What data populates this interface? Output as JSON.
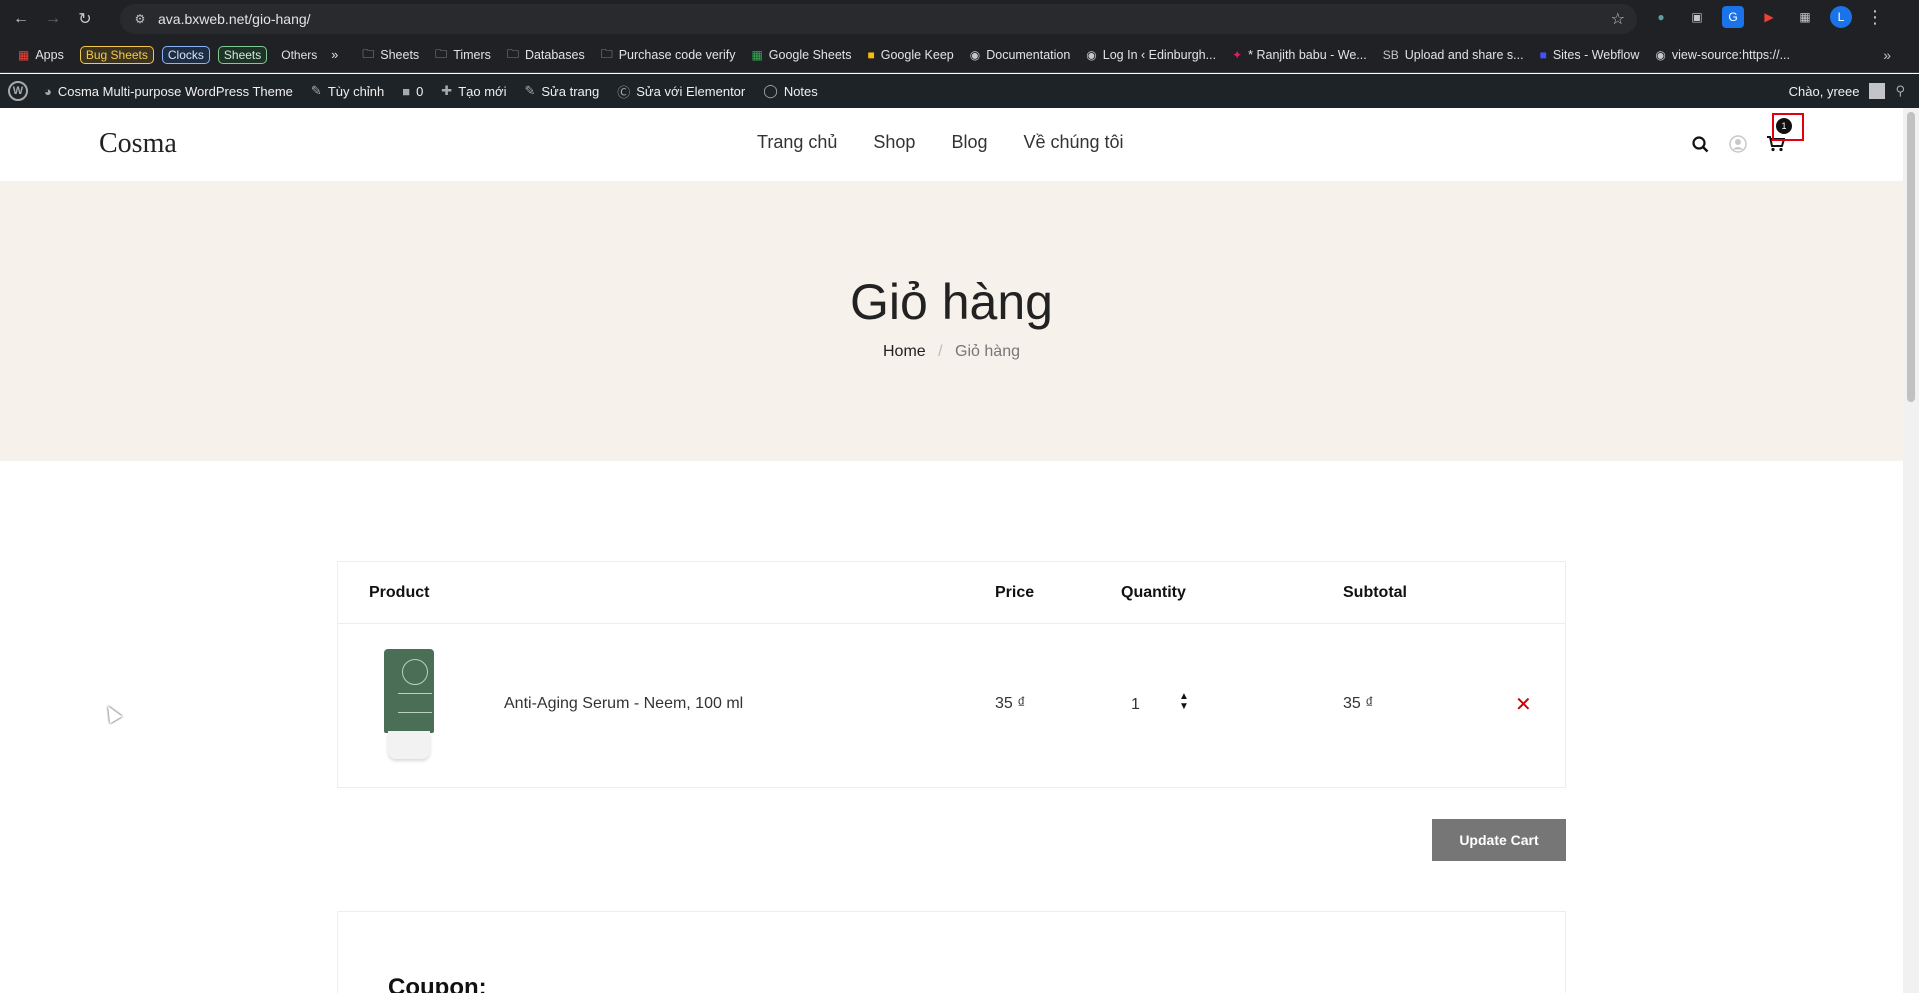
{
  "browser": {
    "url": "ava.bxweb.net/gio-hang/",
    "profile_initial": "L"
  },
  "bookmarks": {
    "apps": "Apps",
    "chips": [
      "Bug Sheets",
      "Clocks",
      "Sheets",
      "Others"
    ],
    "items": [
      "Sheets",
      "Timers",
      "Databases",
      "Purchase code verify",
      "Google Sheets",
      "Google Keep",
      "Documentation",
      "Log In ‹ Edinburgh...",
      "* Ranjith babu - We...",
      "Upload and share s...",
      "Sites - Webflow",
      "view-source:https://..."
    ]
  },
  "wpbar": {
    "site_name": "Cosma Multi-purpose WordPress Theme",
    "customize": "Tùy chỉnh",
    "comments_count": "0",
    "new": "Tạo mới",
    "edit_page": "Sửa trang",
    "edit_elementor": "Sửa với Elementor",
    "notes": "Notes",
    "greeting": "Chào, yreee"
  },
  "site": {
    "logo": "Cosma",
    "nav": [
      "Trang chủ",
      "Shop",
      "Blog",
      "Về chúng tôi"
    ],
    "cart_count": "1"
  },
  "banner": {
    "title": "Giỏ hàng",
    "breadcrumb_home": "Home",
    "breadcrumb_sep": "/",
    "breadcrumb_current": "Giỏ hàng"
  },
  "cart": {
    "headers": {
      "product": "Product",
      "price": "Price",
      "quantity": "Quantity",
      "subtotal": "Subtotal"
    },
    "item": {
      "name": "Anti-Aging Serum - Neem, 100 ml",
      "price": "35 ₫",
      "quantity": "1",
      "subtotal": "35 ₫"
    },
    "update_label": "Update Cart",
    "coupon_label": "Coupon:"
  }
}
